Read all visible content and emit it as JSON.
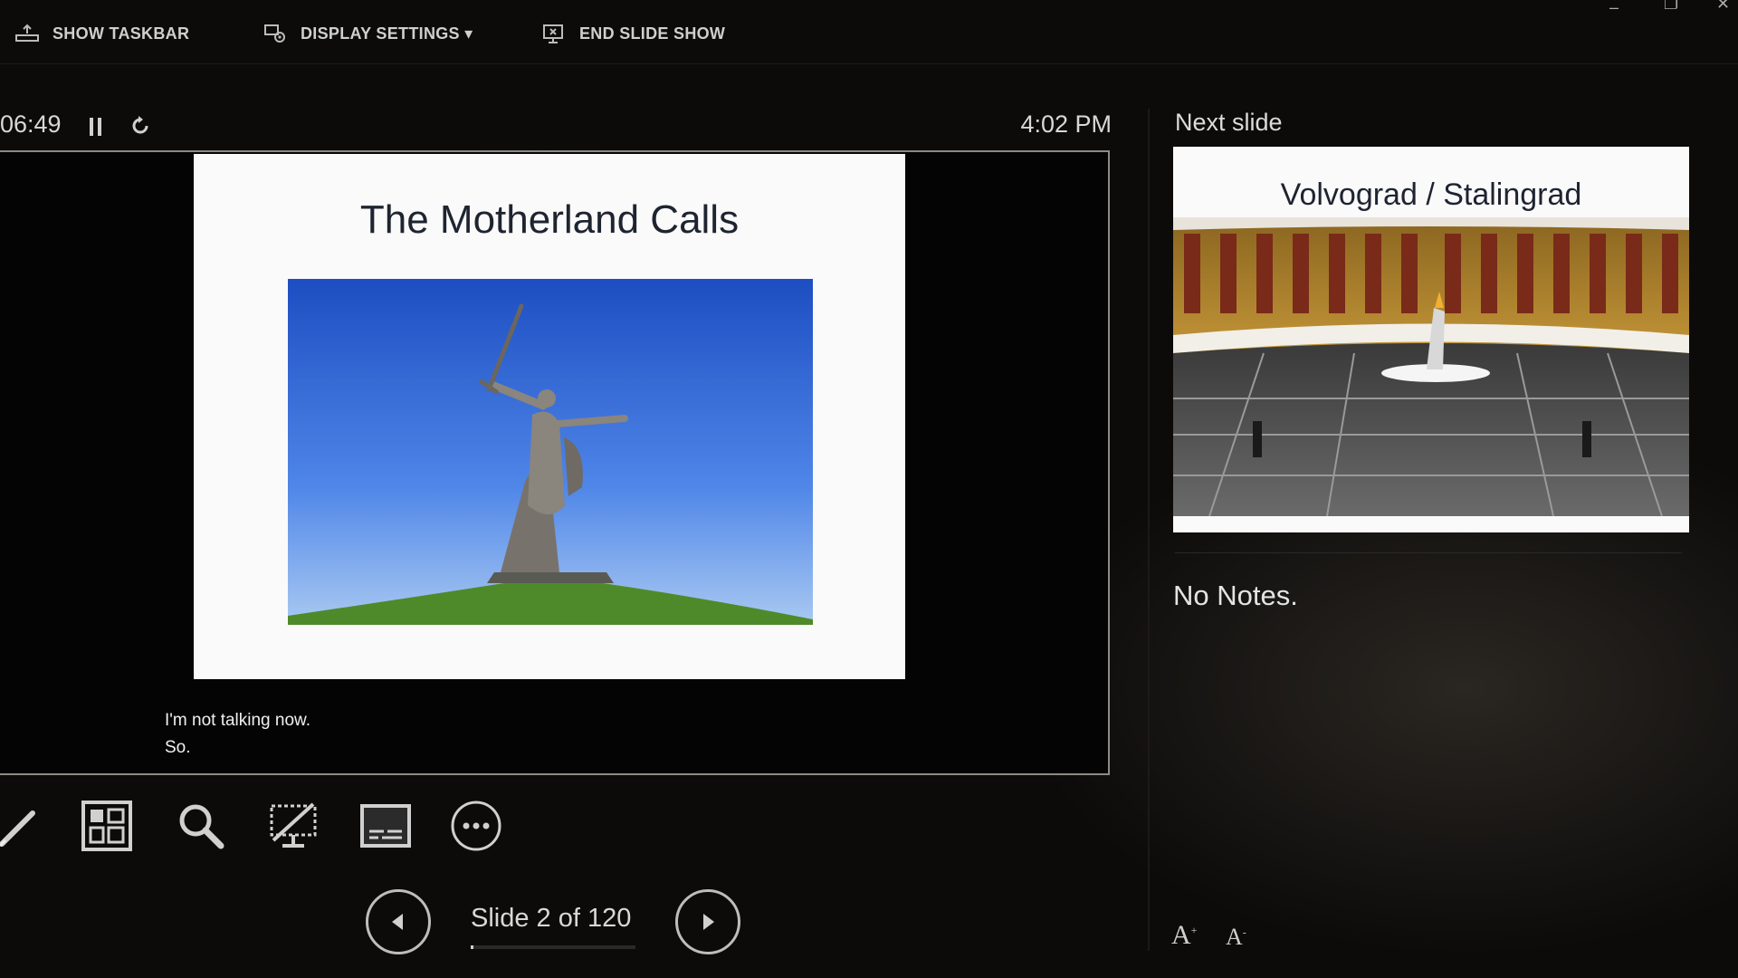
{
  "toolbar": {
    "show_taskbar": "SHOW TASKBAR",
    "display_settings": "DISPLAY SETTINGS ▾",
    "end_slide_show": "END SLIDE SHOW"
  },
  "presenter": {
    "timer": "06:49",
    "clock": "4:02 PM"
  },
  "current_slide": {
    "title": "The Motherland Calls"
  },
  "subtitles": [
    "I'm not talking now.",
    "So."
  ],
  "navigation": {
    "counter": "Slide 2 of 120",
    "current": 2,
    "total": 120
  },
  "next_slide": {
    "label": "Next slide",
    "title": "Volvograd / Stalingrad"
  },
  "notes": {
    "text": "No Notes."
  },
  "font_controls": {
    "increase": "A",
    "decrease": "A"
  },
  "icons": [
    "taskbar-icon",
    "display-settings-icon",
    "end-show-icon",
    "pause-icon",
    "reset-icon",
    "pen-icon",
    "see-all-slides-icon",
    "zoom-icon",
    "black-screen-icon",
    "subtitles-icon",
    "more-options-icon",
    "previous-arrow-icon",
    "next-arrow-icon"
  ]
}
